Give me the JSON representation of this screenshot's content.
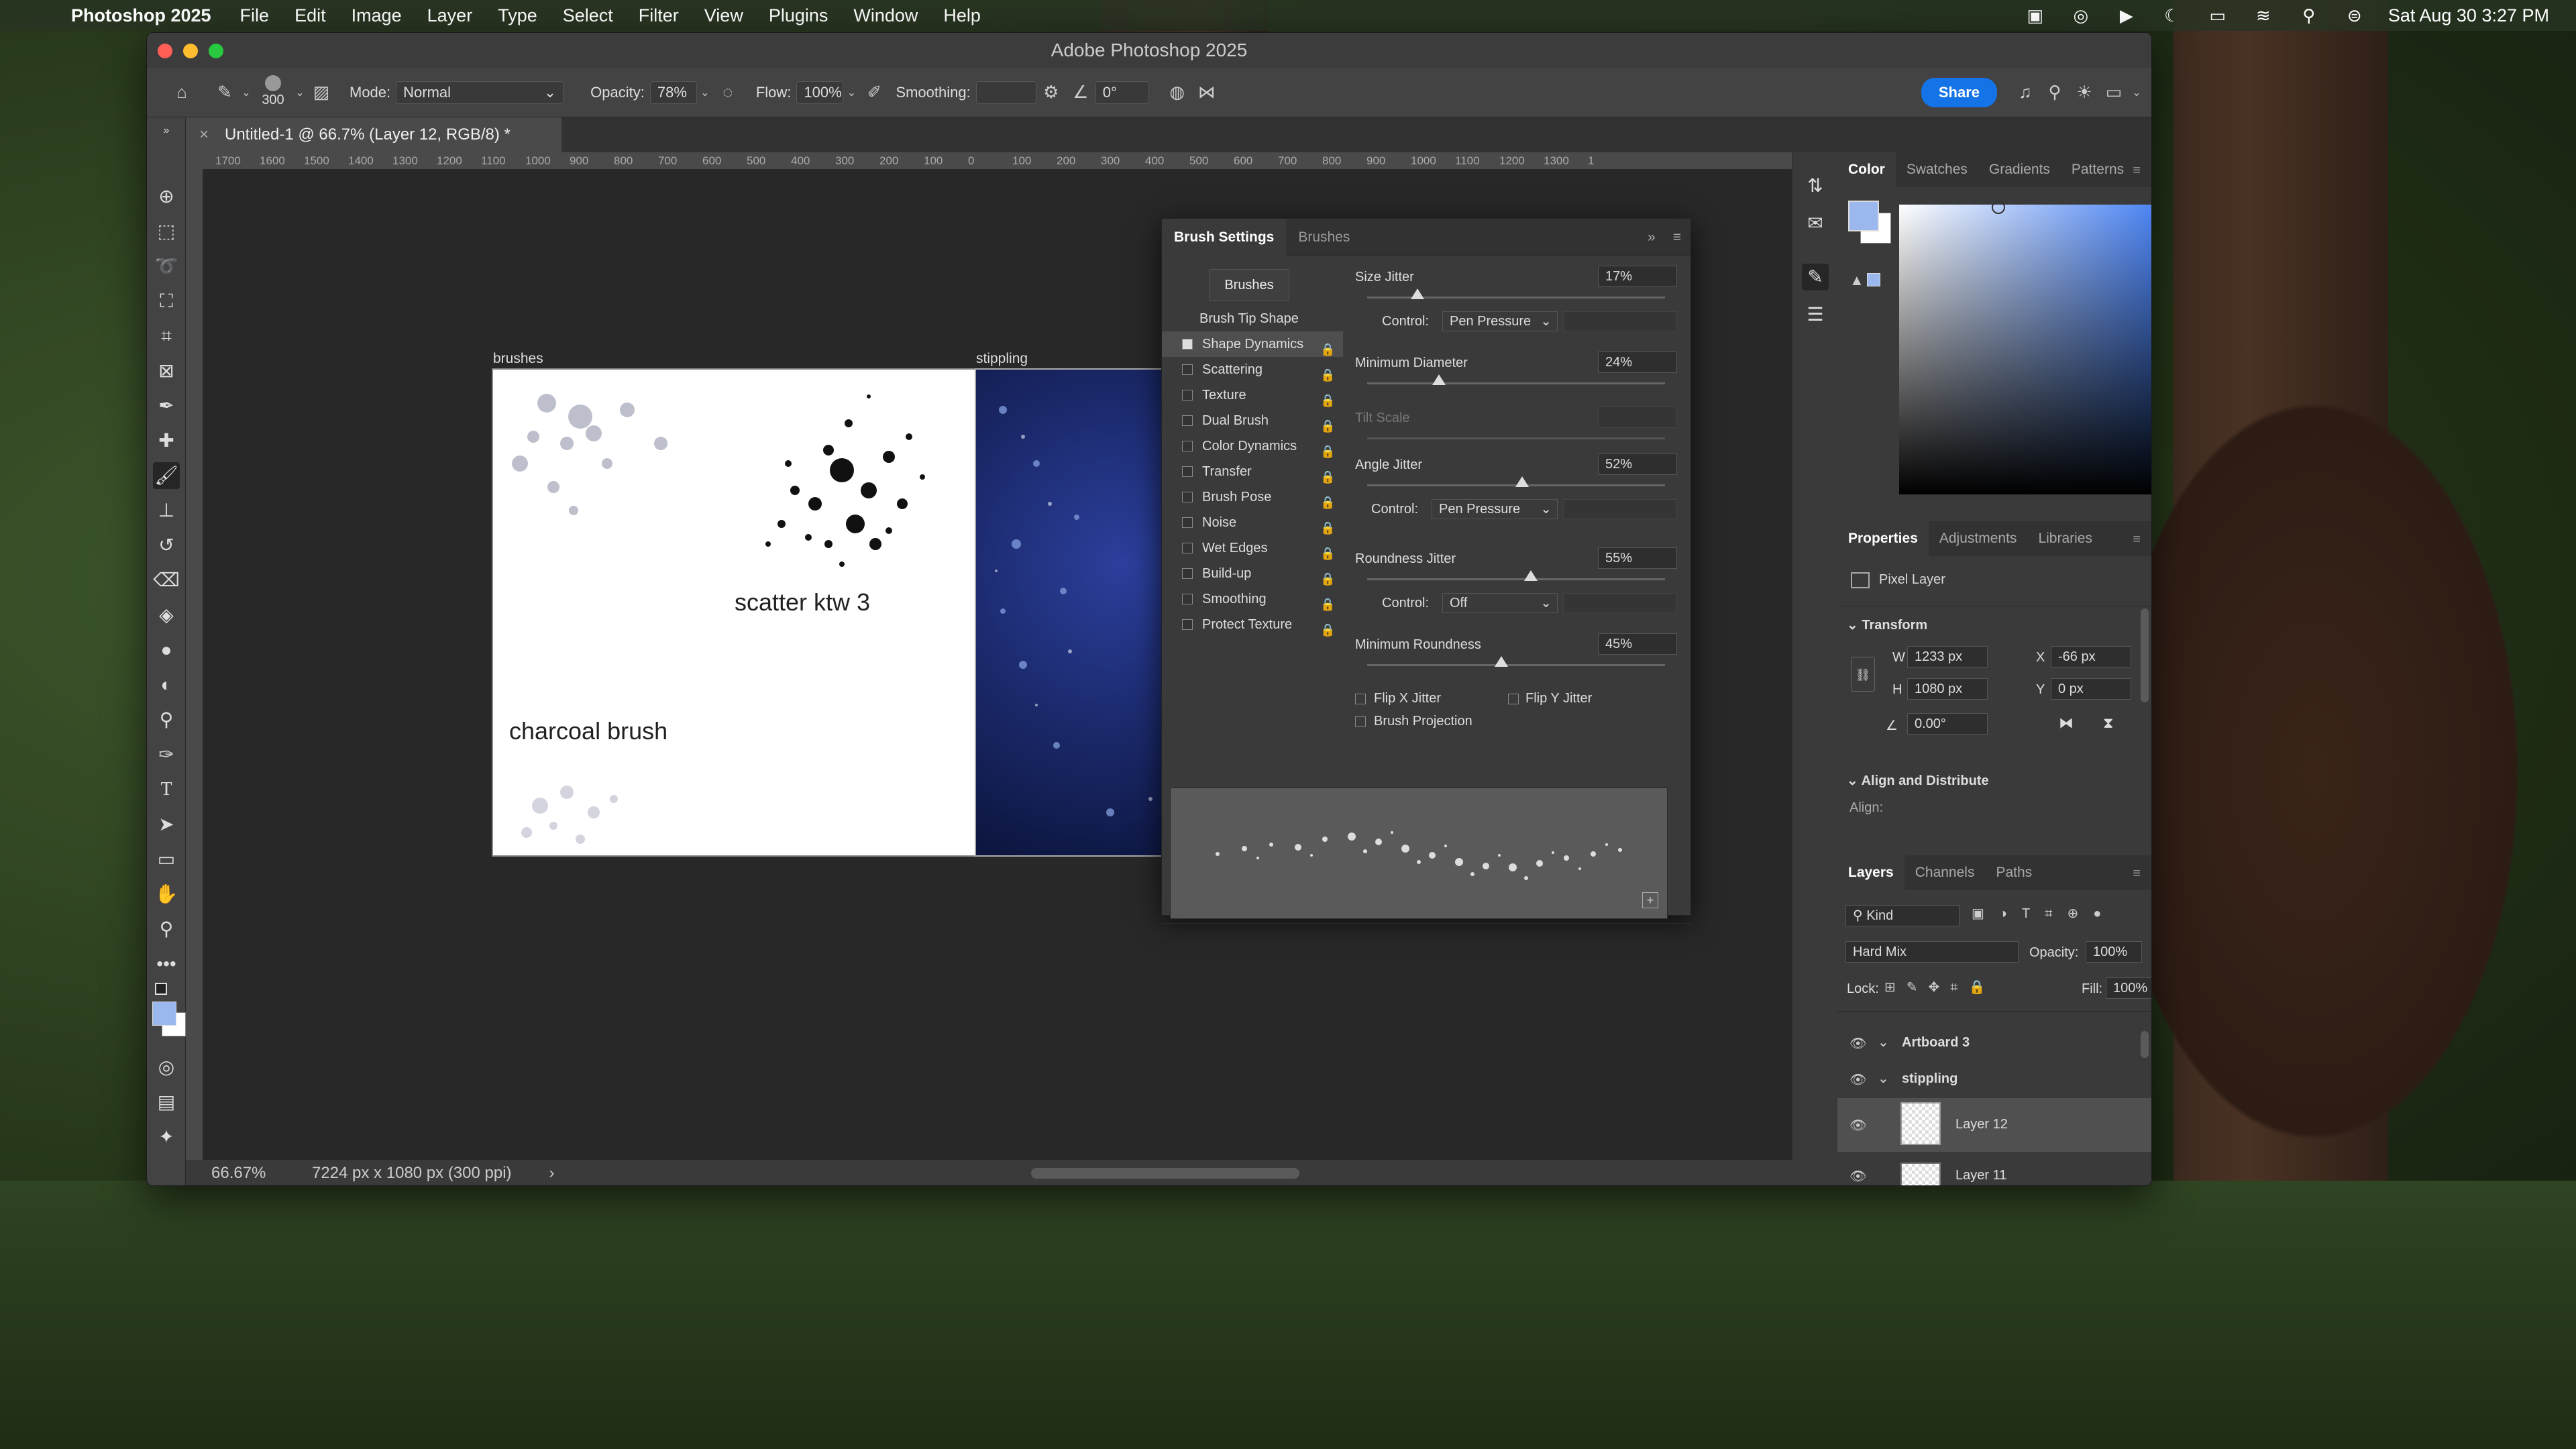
{
  "menubar": {
    "app": "Photoshop 2025",
    "items": [
      "File",
      "Edit",
      "Image",
      "Layer",
      "Type",
      "Select",
      "Filter",
      "View",
      "Plugins",
      "Window",
      "Help"
    ],
    "clock": "Sat Aug 30  3:27 PM"
  },
  "window": {
    "title": "Adobe Photoshop 2025"
  },
  "options": {
    "brush_size": "300",
    "mode_label": "Mode:",
    "mode_value": "Normal",
    "opacity_label": "Opacity:",
    "opacity_value": "78%",
    "flow_label": "Flow:",
    "flow_value": "100%",
    "smoothing_label": "Smoothing:",
    "angle_value": "0°",
    "share_label": "Share"
  },
  "document": {
    "tab_title": "Untitled-1 @ 66.7% (Layer 12, RGB/8) *",
    "zoom": "66.67%",
    "info": "7224 px x 1080 px (300 ppi)"
  },
  "ruler": {
    "ticks": [
      "1700",
      "1600",
      "1500",
      "1400",
      "1300",
      "1200",
      "1100",
      "1000",
      "900",
      "800",
      "700",
      "600",
      "500",
      "400",
      "300",
      "200",
      "100",
      "0",
      "100",
      "200",
      "300",
      "400",
      "500",
      "600",
      "700",
      "800",
      "900",
      "1000",
      "1100",
      "1200",
      "1300",
      "1"
    ]
  },
  "canvas": {
    "artboard1_label": "brushes",
    "artboard2_label": "stippling",
    "scatter_text": "scatter ktw 3",
    "charcoal_text": "charcoal brush"
  },
  "brush_settings": {
    "tab_active": "Brush Settings",
    "tab_other": "Brushes",
    "brushes_button": "Brushes",
    "tip_shape": "Brush Tip Shape",
    "items": [
      {
        "label": "Shape Dynamics",
        "checked": true
      },
      {
        "label": "Scattering",
        "checked": false
      },
      {
        "label": "Texture",
        "checked": false
      },
      {
        "label": "Dual Brush",
        "checked": false
      },
      {
        "label": "Color Dynamics",
        "checked": false
      },
      {
        "label": "Transfer",
        "checked": false
      },
      {
        "label": "Brush Pose",
        "checked": false
      },
      {
        "label": "Noise",
        "checked": false
      },
      {
        "label": "Wet Edges",
        "checked": false
      },
      {
        "label": "Build-up",
        "checked": false
      },
      {
        "label": "Smoothing",
        "checked": false
      },
      {
        "label": "Protect Texture",
        "checked": false
      }
    ],
    "size_jitter_label": "Size Jitter",
    "size_jitter": "17%",
    "size_jitter_level": 0.17,
    "control_label": "Control:",
    "control1": "Pen Pressure",
    "min_diameter_label": "Minimum Diameter",
    "min_diameter": "24%",
    "min_diameter_level": 0.24,
    "tilt_scale_label": "Tilt Scale",
    "angle_jitter_label": "Angle Jitter",
    "angle_jitter": "52%",
    "angle_jitter_level": 0.52,
    "control2": "Pen Pressure",
    "roundness_jitter_label": "Roundness Jitter",
    "roundness_jitter": "55%",
    "roundness_jitter_level": 0.55,
    "control3": "Off",
    "min_roundness_label": "Minimum Roundness",
    "min_roundness": "45%",
    "min_roundness_level": 0.45,
    "flip_x": "Flip X Jitter",
    "flip_y": "Flip Y Jitter",
    "brush_projection": "Brush Projection"
  },
  "color_panel": {
    "tabs": [
      "Color",
      "Swatches",
      "Gradients",
      "Patterns"
    ],
    "fg": "#9bb8ee",
    "bg": "#ffffff"
  },
  "properties": {
    "tabs": [
      "Properties",
      "Adjustments",
      "Libraries"
    ],
    "kind": "Pixel Layer",
    "transform": "Transform",
    "w_label": "W",
    "w": "1233 px",
    "x_label": "X",
    "x": "-66 px",
    "h_label": "H",
    "h": "1080 px",
    "y_label": "Y",
    "y": "0 px",
    "angle": "0.00°",
    "align_title": "Align and Distribute",
    "align_label": "Align:"
  },
  "layers": {
    "tabs": [
      "Layers",
      "Channels",
      "Paths"
    ],
    "kind": "Kind",
    "blend": "Hard Mix",
    "opacity_label": "Opacity:",
    "opacity": "100%",
    "lock_label": "Lock:",
    "fill_label": "Fill:",
    "fill": "100%",
    "rows": [
      {
        "name": "Artboard 3"
      },
      {
        "name": "stippling"
      },
      {
        "name": "Layer 12"
      },
      {
        "name": "Layer 11"
      }
    ]
  }
}
